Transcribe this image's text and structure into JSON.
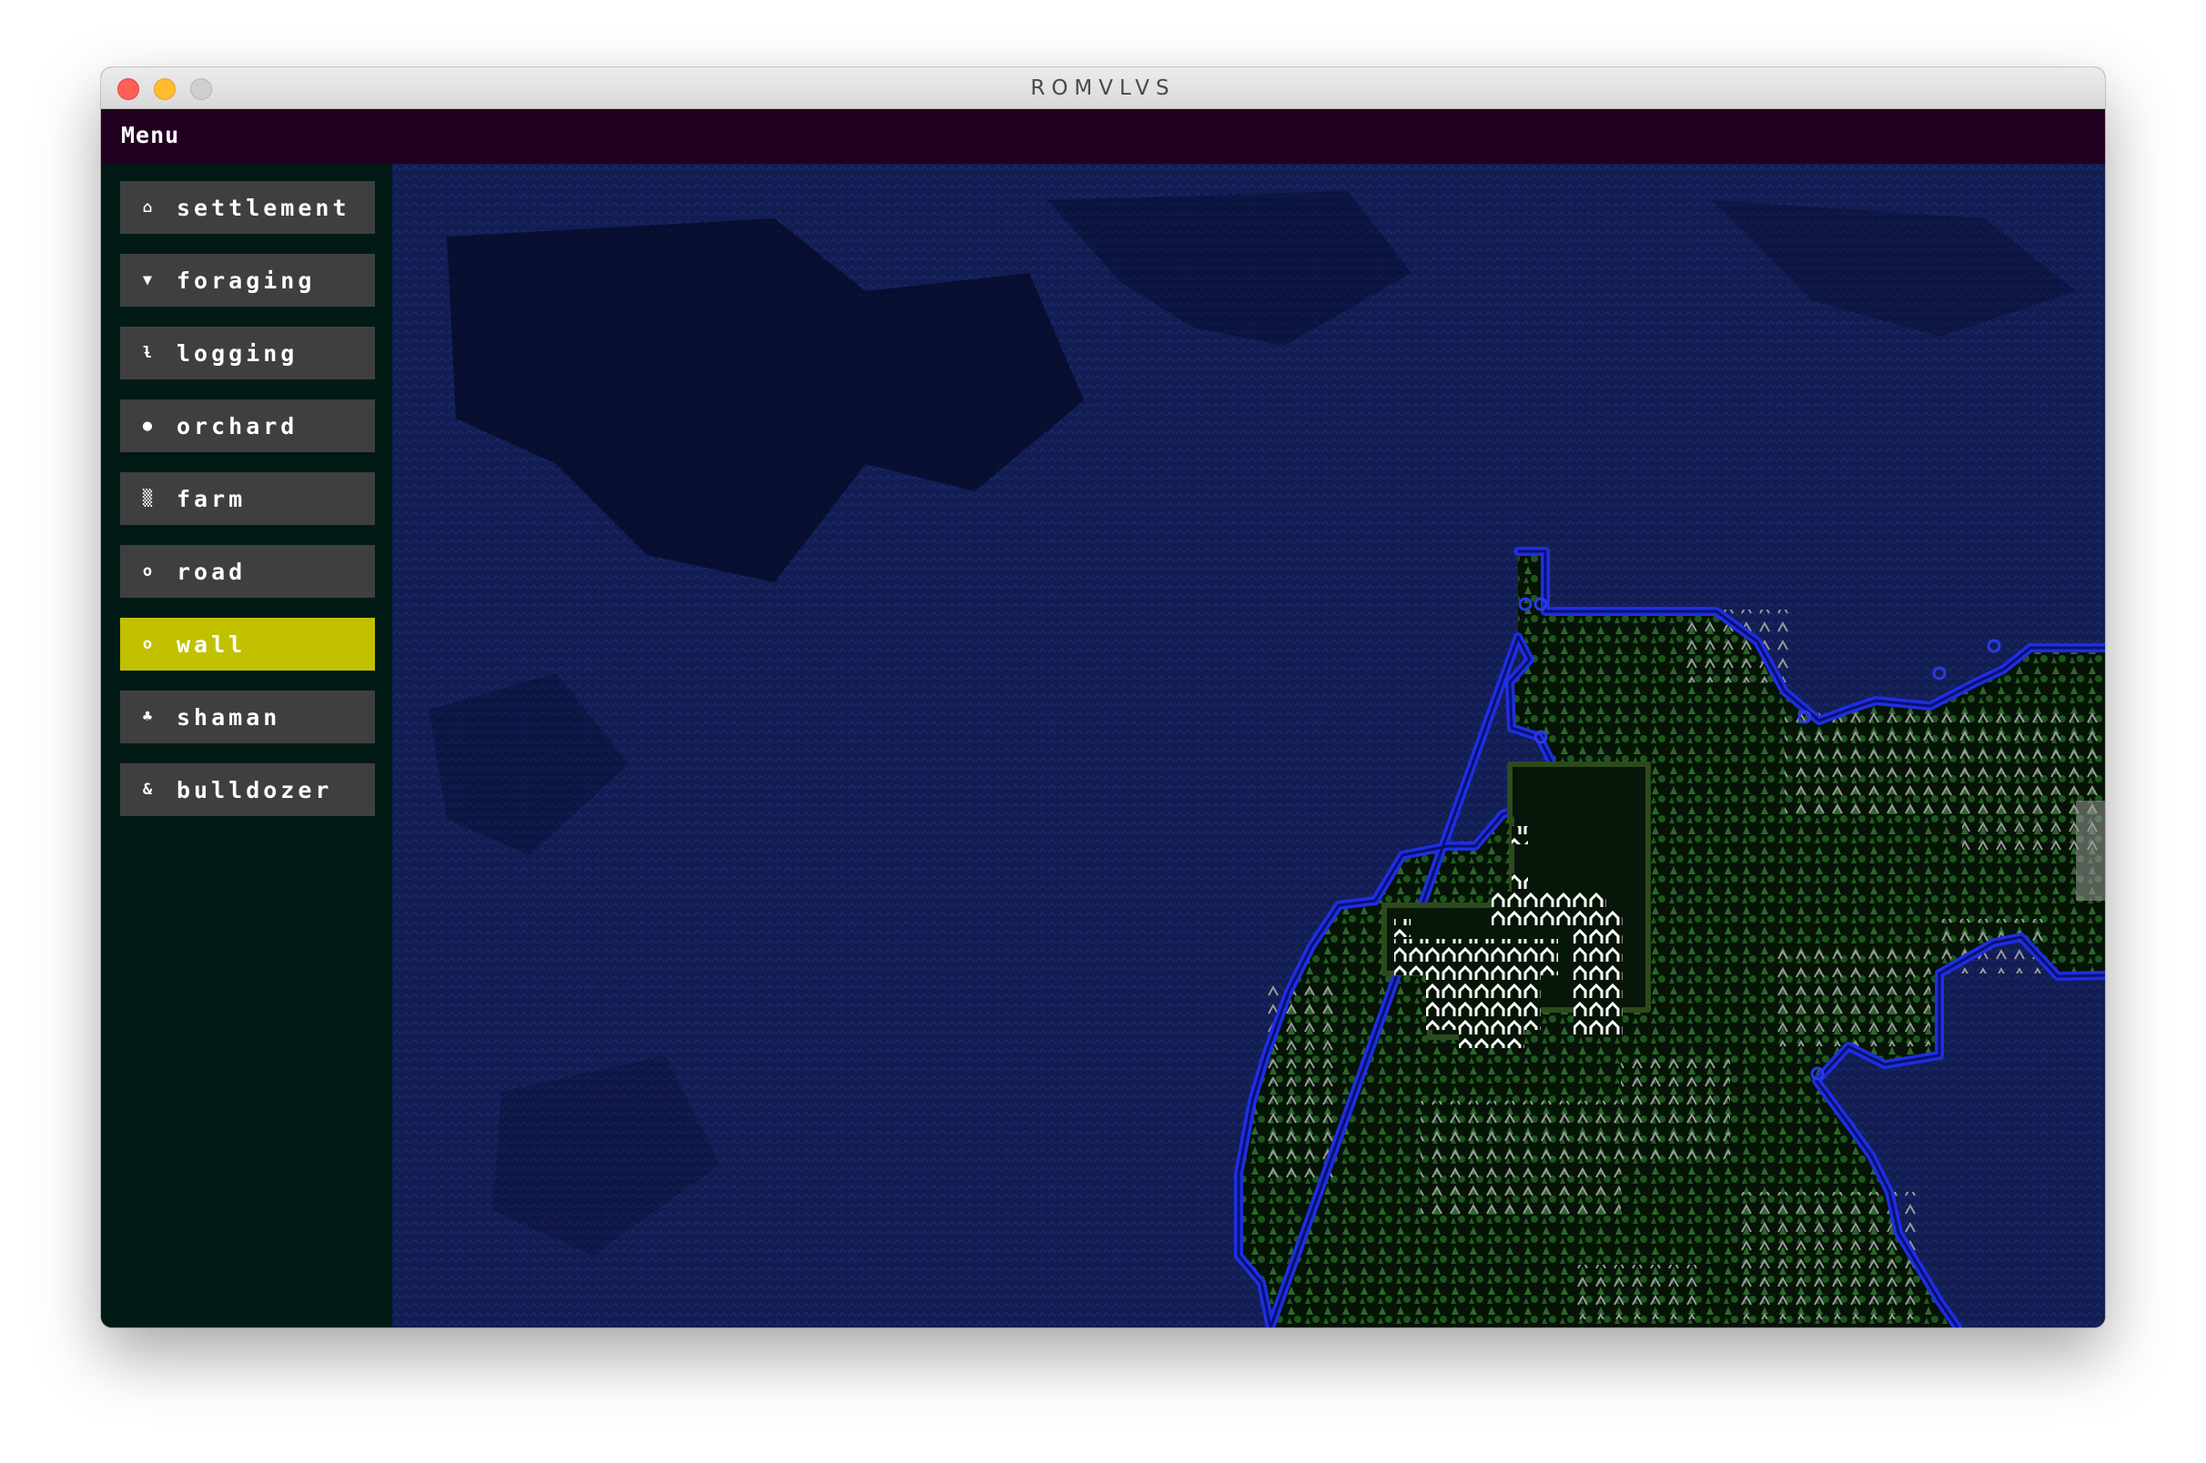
{
  "window": {
    "title": "ROMVLVS"
  },
  "menubar": {
    "menu_label": "Menu"
  },
  "sidebar": {
    "tools": [
      {
        "id": "settlement",
        "label": "settlement",
        "icon": "house-icon",
        "active": false
      },
      {
        "id": "foraging",
        "label": "foraging",
        "icon": "basket-icon",
        "active": false
      },
      {
        "id": "logging",
        "label": "logging",
        "icon": "axe-icon",
        "active": false
      },
      {
        "id": "orchard",
        "label": "orchard",
        "icon": "fruit-tree-icon",
        "active": false
      },
      {
        "id": "farm",
        "label": "farm",
        "icon": "crop-field-icon",
        "active": false
      },
      {
        "id": "road",
        "label": "road",
        "icon": "road-dot-icon",
        "active": false
      },
      {
        "id": "wall",
        "label": "wall",
        "icon": "wall-ring-icon",
        "active": true
      },
      {
        "id": "shaman",
        "label": "shaman",
        "icon": "shaman-icon",
        "active": false
      },
      {
        "id": "bulldozer",
        "label": "bulldozer",
        "icon": "bulldozer-icon",
        "active": false
      }
    ]
  },
  "colors": {
    "menubar": "#21001f",
    "sidebar": "#011a16",
    "button": "#3f3f3f",
    "active_button": "#c1c100",
    "ocean": "#0d1640",
    "ocean_deep": "#060a24",
    "land": "#0c2a0c",
    "tree": "#2a6b2a",
    "mountain": "#8a8a8a",
    "coast_wall": "#2030d8",
    "settlement": "#ffffff",
    "settlement_border": "#2c4a1c"
  }
}
